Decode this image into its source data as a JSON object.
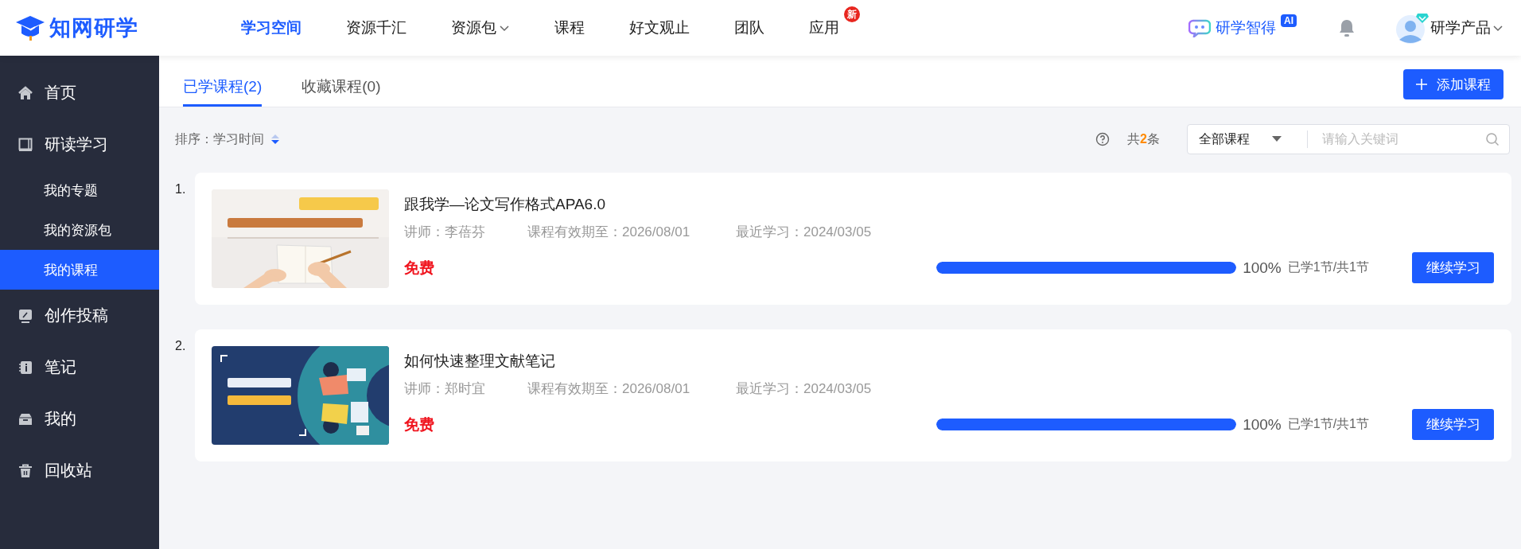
{
  "header": {
    "logo": "知网研学",
    "nav": [
      {
        "label": "学习空间",
        "selected": true
      },
      {
        "label": "资源千汇",
        "selected": false
      },
      {
        "label": "资源包",
        "selected": false,
        "dropdown": true
      },
      {
        "label": "课程",
        "selected": false
      },
      {
        "label": "好文观止",
        "selected": false
      },
      {
        "label": "团队",
        "selected": false
      },
      {
        "label": "应用",
        "selected": false,
        "badge": "新"
      }
    ],
    "assistant": {
      "label": "研学智得",
      "badge": "AI"
    },
    "user": {
      "name": "研学产品"
    }
  },
  "sidebar": {
    "items": [
      {
        "label": "首页",
        "selected": false
      },
      {
        "label": "研读学习",
        "selected": false,
        "children": [
          {
            "label": "我的专题",
            "selected": false
          },
          {
            "label": "我的资源包",
            "selected": false
          },
          {
            "label": "我的课程",
            "selected": true
          }
        ]
      },
      {
        "label": "创作投稿",
        "selected": false
      },
      {
        "label": "笔记",
        "selected": false
      },
      {
        "label": "我的",
        "selected": false
      },
      {
        "label": "回收站",
        "selected": false
      }
    ]
  },
  "tabs": [
    {
      "label": "已学课程(2)",
      "selected": true
    },
    {
      "label": "收藏课程(0)",
      "selected": false
    }
  ],
  "add_button": "添加课程",
  "toolbar": {
    "sort_label": "排序：",
    "sort_value": "学习时间",
    "count_prefix": "共",
    "count": "2",
    "count_suffix": "条",
    "filter": "全部课程",
    "search": {
      "placeholder": "请输入关键词"
    }
  },
  "courses": [
    {
      "number": "1.",
      "title": "跟我学—论文写作格式APA6.0",
      "instructor_label": "讲师：",
      "instructor": "李蓓芬",
      "valid_label": "课程有效期至：",
      "valid_until": "2026/08/01",
      "recent_label": "最近学习：",
      "recent": "2024/03/05",
      "price": "免费",
      "level": 1,
      "percent": "100%",
      "progress_text": "已学1节/共1节",
      "action": "继续学习"
    },
    {
      "number": "2.",
      "title": "如何快速整理文献笔记",
      "instructor_label": "讲师：",
      "instructor": "郑时宜",
      "valid_label": "课程有效期至：",
      "valid_until": "2026/08/01",
      "recent_label": "最近学习：",
      "recent": "2024/03/05",
      "price": "免费",
      "level": 1,
      "percent": "100%",
      "progress_text": "已学1节/共1节",
      "action": "继续学习"
    }
  ]
}
